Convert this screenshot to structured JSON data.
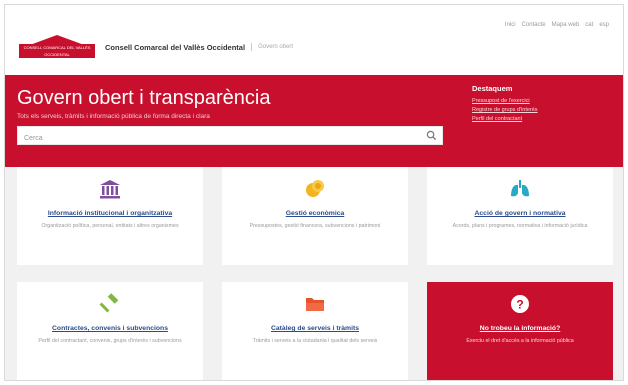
{
  "header": {
    "top_links": [
      "Inici",
      "Contacte",
      "Mapa web",
      "cat",
      "esp"
    ],
    "logo_text": "CONSELL COMARCAL DEL VALLÈS OCCIDENTAL",
    "org_name": "Consell Comarcal del Vallès Occidental",
    "org_sub": "Govern obert"
  },
  "hero": {
    "title": "Govern obert i transparència",
    "subtitle": "Tots els serveis, tràmits i informació pública de forma directa i clara",
    "search_placeholder": "Cerca",
    "featured_heading": "Destaquem",
    "featured_links": [
      "Pressupost de l'exercici",
      "Registre de grups d'interès",
      "Perfil del contractant"
    ]
  },
  "cards": [
    {
      "title": "Informació institucional i organitzativa",
      "desc": "Organització política, personal, entitats i altres organismes",
      "icon": "institution-icon",
      "color": "#7f4e9e"
    },
    {
      "title": "Gestió econòmica",
      "desc": "Pressupostes, gestió financera, subvencions i patrimoni",
      "icon": "coins-icon",
      "color": "#f2b51e"
    },
    {
      "title": "Acció de govern i normativa",
      "desc": "Acords, plans i programes, normativa i informació jurídica",
      "icon": "lungs-icon",
      "color": "#2aa9c6"
    },
    {
      "title": "Contractes, convenis i subvencions",
      "desc": "Perfil del contractant, convenis, grups d'interès i subvencions",
      "icon": "gavel-icon",
      "color": "#7fb93f"
    },
    {
      "title": "Catàleg de serveis i tràmits",
      "desc": "Tràmits i serveis a la ciutadania i qualitat dels serveis",
      "icon": "folder-icon",
      "color": "#e8532b"
    },
    {
      "title": "No trobeu la informació?",
      "desc": "Exerciu el dret d'accés a la informació pública",
      "icon": "question-icon",
      "color": "#ffffff"
    }
  ]
}
